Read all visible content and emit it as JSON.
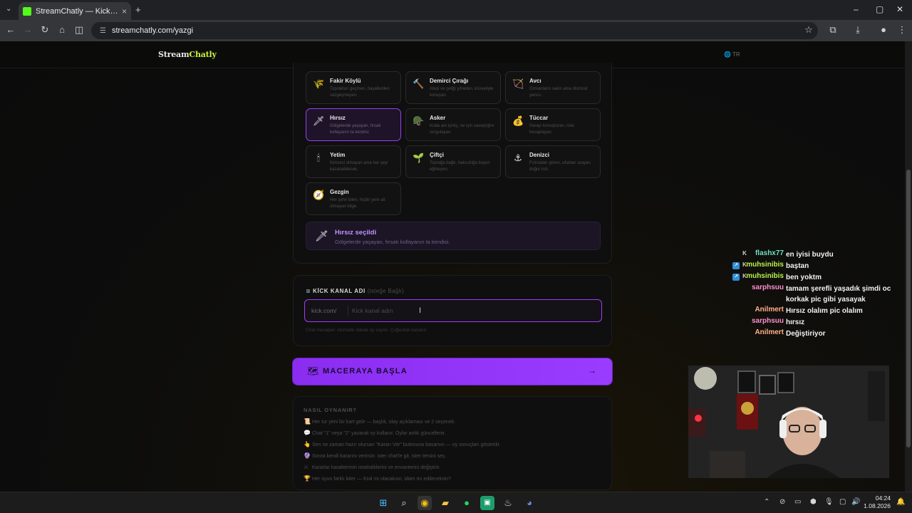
{
  "browser": {
    "tab_title": "StreamChatly — Kick Yayıncıları...",
    "url": "streamchatly.com/yazgi",
    "window_controls": [
      "–",
      "▢",
      "✕"
    ]
  },
  "site": {
    "logo_part1": "Stream",
    "logo_part2": "Chatly",
    "language": "TR"
  },
  "classes": [
    {
      "name": "Fakir Köylü",
      "desc": "Toprakları geçmen, hayallerden vazgeçmeyen.",
      "icon": "🌾",
      "selected": false
    },
    {
      "name": "Demirci Çırağı",
      "desc": "Ateşi ve çeliği yöneten, küvvetiyle konuşan.",
      "icon": "🔨",
      "selected": false
    },
    {
      "name": "Avcı",
      "desc": "Ormanların sakin ama ölümcül yanısı.",
      "icon": "🏹",
      "selected": false
    },
    {
      "name": "Hırsız",
      "desc": "Gölgelerde yaşayan, fırsatı kollayanın ta kendisi.",
      "icon": "🗡",
      "selected": true
    },
    {
      "name": "Asker",
      "desc": "Krala ant içmiş, ne için savaştığını sorgulayan.",
      "icon": "🪖",
      "selected": false
    },
    {
      "name": "Tüccar",
      "desc": "Parayı konuşturan, riski hesaplayan.",
      "icon": "💰",
      "selected": false
    },
    {
      "name": "Yetim",
      "desc": "Kimsesi olmayan ama her şeyi kazanabilecek.",
      "icon": "🕯",
      "selected": false
    },
    {
      "name": "Çiftçi",
      "desc": "Toprağa bağlı, haksızlığa boyun eğmeyen.",
      "icon": "🌱",
      "selected": false
    },
    {
      "name": "Denizci",
      "desc": "Fırtınaları gören, ufukları arayan doğur ruh.",
      "icon": "⚓",
      "selected": false
    },
    {
      "name": "Gezgin",
      "desc": "Her şehri bilen, hiçbir yere ait olmayan bilge.",
      "icon": "🧭",
      "selected": false
    }
  ],
  "selected_banner": {
    "title": "Hırsız seçildi",
    "desc": "Gölgelerde yaşayan, fırsatı kollayanın ta kendisi."
  },
  "kick": {
    "label": "KİCK KANAL ADI",
    "optional": "(isteğe Bağlı)",
    "prefix": "kick.com/",
    "placeholder": "Kick kanal adın",
    "value": "",
    "hint": "Chat mesajları otomatik olarak oy sayılır. Çoğunluk kazanır."
  },
  "start_button": {
    "label": "MACERAYA BAŞLA",
    "arrow": "→"
  },
  "how_to": {
    "title": "NASIL OYNANIR?",
    "items": [
      {
        "emoji": "📜",
        "text": "Her tur yeni bir kart gelir — başlık, olay açıklaması ve 2 seçenek."
      },
      {
        "emoji": "💬",
        "text": "Chat \"1\" veya \"2\" yazarak oy kullanır. Oylar anlık güncellenir."
      },
      {
        "emoji": "👆",
        "text": "Sen ne zaman hazır olursan \"Kararı Ver\" butonuna basarsın — oy sonuçları gösterilir."
      },
      {
        "emoji": "🔮",
        "text": "Sonra kendi kararını verirsin: ister chat'le git, ister tersini seç."
      },
      {
        "emoji": "⚔",
        "text": "Kararlar karakterinin istatistiklerini ve envanterini değiştirir."
      },
      {
        "emoji": "🏆",
        "text": "Her oyun farklı biter — Kral mı olacaksın, idam mı edileceksin?"
      }
    ]
  },
  "chat": [
    {
      "user": "flashx77",
      "color": "#6fe0c4",
      "badges": [
        "kk"
      ],
      "msg": "en iyisi buydu"
    },
    {
      "user": "muhsinibis",
      "color": "#b7f24b",
      "badges": [
        "sub",
        "kk"
      ],
      "msg": "baştan"
    },
    {
      "user": "muhsinibis",
      "color": "#b7f24b",
      "badges": [
        "sub",
        "kk"
      ],
      "msg": "ben yoktm"
    },
    {
      "user": "sarphsuu",
      "color": "#ff8fd0",
      "badges": [],
      "msg": "tamam şerefli yaşadık şimdi oc korkak pic gibi yasayak"
    },
    {
      "user": "Anilmert",
      "color": "#ffb08a",
      "badges": [],
      "msg": "Hırsız olalım pic olalım"
    },
    {
      "user": "sarphsuu",
      "color": "#ff8fd0",
      "badges": [],
      "msg": "hırsız"
    },
    {
      "user": "Anilmert",
      "color": "#ffb08a",
      "badges": [],
      "msg": "Değiştiriyor"
    }
  ],
  "taskbar": {
    "time": "04:24",
    "date": "1.08.2026"
  },
  "colors": {
    "accent": "#9b3ff5",
    "brand_green": "#c9f23a"
  }
}
